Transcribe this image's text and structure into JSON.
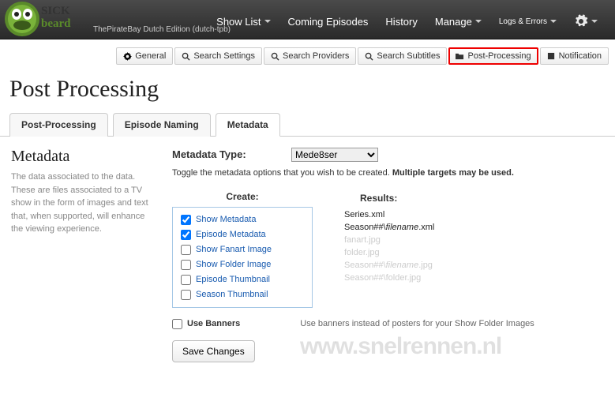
{
  "header": {
    "edition": "ThePirateBay Dutch Edition (dutch-tpb)",
    "nav": [
      "Show List",
      "Coming Episodes",
      "History",
      "Manage",
      "Logs & Errors"
    ]
  },
  "subnav": [
    {
      "label": "General",
      "icon": "gear"
    },
    {
      "label": "Search Settings",
      "icon": "search"
    },
    {
      "label": "Search Providers",
      "icon": "search"
    },
    {
      "label": "Search Subtitles",
      "icon": "search"
    },
    {
      "label": "Post-Processing",
      "icon": "folder",
      "active": true
    },
    {
      "label": "Notification",
      "icon": "square"
    }
  ],
  "page_title": "Post Processing",
  "tabs": [
    "Post-Processing",
    "Episode Naming",
    "Metadata"
  ],
  "active_tab": 2,
  "sidebar": {
    "heading": "Metadata",
    "desc": "The data associated to the data. These are files associated to a TV show in the form of images and text that, when supported, will enhance the viewing experience."
  },
  "meta": {
    "type_label": "Metadata Type:",
    "type_value": "Mede8ser",
    "toggle_desc_a": "Toggle the metadata options that you wish to be created. ",
    "toggle_desc_b": "Multiple targets may be used.",
    "create_head": "Create:",
    "results_head": "Results:",
    "options": [
      {
        "label": "Show Metadata",
        "checked": true
      },
      {
        "label": "Episode Metadata",
        "checked": true
      },
      {
        "label": "Show Fanart Image",
        "checked": false
      },
      {
        "label": "Show Folder Image",
        "checked": false
      },
      {
        "label": "Episode Thumbnail",
        "checked": false
      },
      {
        "label": "Season Thumbnail",
        "checked": false
      }
    ],
    "results": [
      {
        "pre": "Series",
        "it": "",
        "post": ".xml",
        "dim": false
      },
      {
        "pre": "Season##\\",
        "it": "filename",
        "post": ".xml",
        "dim": false
      },
      {
        "pre": "fanart.jpg",
        "it": "",
        "post": "",
        "dim": true
      },
      {
        "pre": "folder.jpg",
        "it": "",
        "post": "",
        "dim": true
      },
      {
        "pre": "Season##\\",
        "it": "filename",
        "post": ".jpg",
        "dim": true
      },
      {
        "pre": "Season##\\folder.jpg",
        "it": "",
        "post": "",
        "dim": true
      }
    ],
    "banners_label": "Use Banners",
    "banners_hint": "Use banners instead of posters for your Show Folder Images",
    "save_label": "Save Changes"
  },
  "watermark": "www.snelrennen.nl"
}
